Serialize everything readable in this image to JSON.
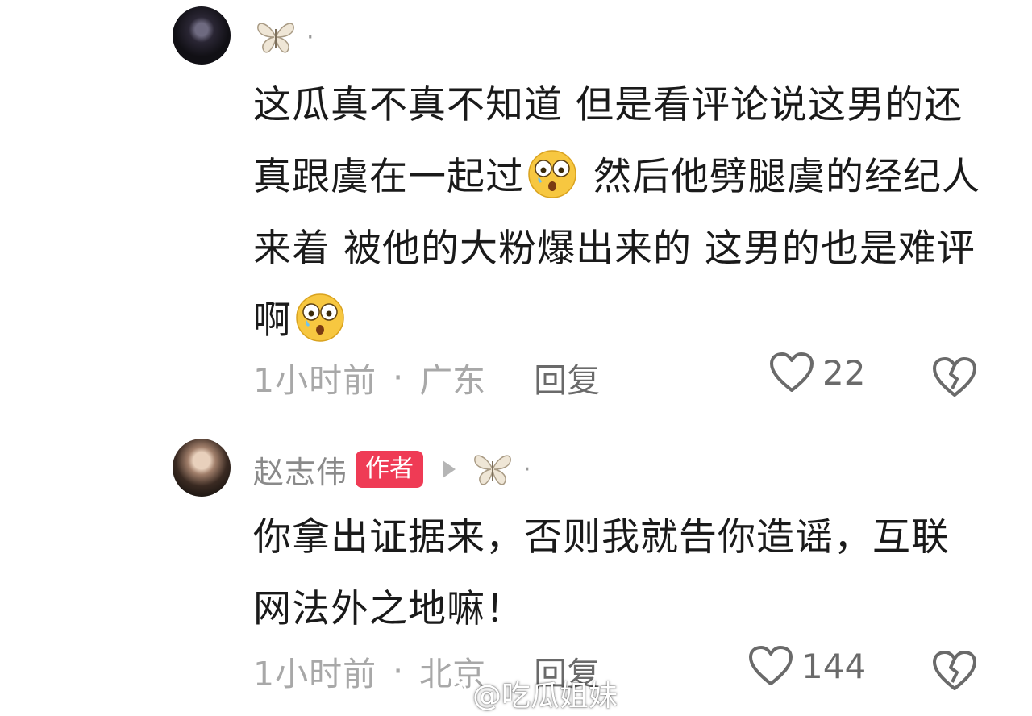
{
  "comments": [
    {
      "username": "",
      "text_part1": "这瓜真不真不知道 但是看评论说这男的还真跟虞在一起过",
      "text_part2": " 然后他劈腿虞的经纪人来着 被他的大粉爆出来的 这男的也是难评啊",
      "time": "1小时前",
      "dot": "·",
      "location": "广东",
      "reply_label": "回复",
      "likes": "22"
    },
    {
      "username": "赵志伟",
      "badge": "作者",
      "text": "你拿出证据来，否则我就告你造谣，互联网法外之地嘛！",
      "time": "1小时前",
      "dot": "·",
      "location": "北京",
      "reply_label": "回复",
      "likes": "144"
    }
  ],
  "name_dot": "·",
  "watermark": "@吃瓜姐妹",
  "icons": [
    "butterfly-icon",
    "shocked-emoji-icon",
    "heart-icon",
    "broken-heart-icon",
    "weibo-icon",
    "arrow-icon"
  ],
  "colors": {
    "badge": "#ef3b55",
    "meta": "#a8a8a8",
    "body": "#1a1a1a"
  }
}
